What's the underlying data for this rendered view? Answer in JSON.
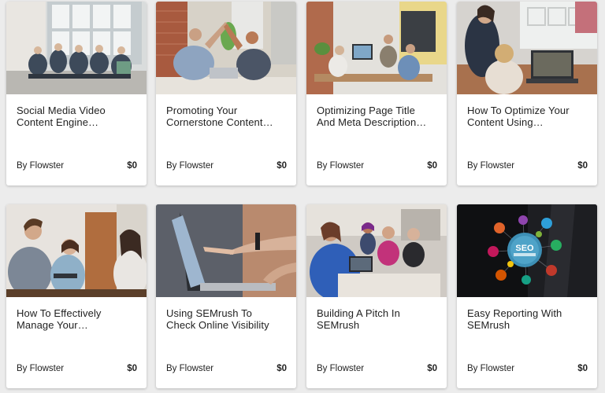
{
  "courses": [
    {
      "title_line1": "Social Media Video",
      "title_line2": "Content Engine…",
      "author": "By Flowster",
      "price": "$0",
      "image": "group-on-floor-laptops-photo"
    },
    {
      "title_line1": "Promoting Your",
      "title_line2": "Cornerstone Content…",
      "author": "By Flowster",
      "price": "$0",
      "image": "office-high-five-photo"
    },
    {
      "title_line1": "Optimizing Page Title",
      "title_line2": "And Meta Description…",
      "author": "By Flowster",
      "price": "$0",
      "image": "office-team-at-desk-photo"
    },
    {
      "title_line1": "How To Optimize Your",
      "title_line2": "Content Using…",
      "author": "By Flowster",
      "price": "$0",
      "image": "women-with-laptop-photo"
    },
    {
      "title_line1": "How To Effectively",
      "title_line2": "Manage Your…",
      "author": "By Flowster",
      "price": "$0",
      "image": "friends-with-tablet-photo"
    },
    {
      "title_line1": "Using SEMrush To",
      "title_line2": "Check Online Visibility",
      "author": "By Flowster",
      "price": "$0",
      "image": "hand-pointing-at-laptop-photo"
    },
    {
      "title_line1": "Building A Pitch In",
      "title_line2": "SEMrush",
      "author": "By Flowster",
      "price": "$0",
      "image": "meeting-around-laptop-photo"
    },
    {
      "title_line1": "Easy Reporting With",
      "title_line2": "SEMrush",
      "author": "By Flowster",
      "price": "$0",
      "image": "seo-process-diagram-photo",
      "image_text": "SEO"
    }
  ]
}
